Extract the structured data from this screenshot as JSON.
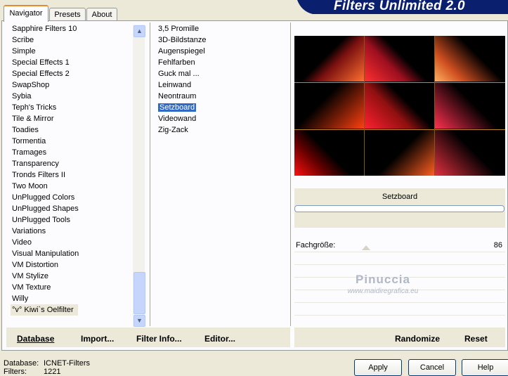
{
  "app": {
    "title": "Filters Unlimited 2.0"
  },
  "tabs": [
    {
      "label": "Navigator",
      "active": true
    },
    {
      "label": "Presets",
      "active": false
    },
    {
      "label": "About",
      "active": false
    }
  ],
  "categories": [
    "Sapphire Filters 10",
    "Scribe",
    "Simple",
    "Special Effects 1",
    "Special Effects 2",
    "SwapShop",
    "Sybia",
    "Teph's Tricks",
    "Tile & Mirror",
    "Toadies",
    "Tormentia",
    "Tramages",
    "Transparency",
    "Tronds Filters II",
    "Two Moon",
    "UnPlugged Colors",
    "UnPlugged Shapes",
    "UnPlugged Tools",
    "Variations",
    "Video",
    "Visual Manipulation",
    "VM Distortion",
    "VM Stylize",
    "VM Texture",
    "Willy",
    "°v° Kiwi`s Oelfilter"
  ],
  "selected_category": "°v° Kiwi`s Oelfilter",
  "filters": [
    "3,5 Promille",
    "3D-Bildstanze",
    "Augenspiegel",
    "Fehlfarben",
    "Guck mal ...",
    "Leinwand",
    "Neontraum",
    "Setzboard",
    "Videowand",
    "Zig-Zack"
  ],
  "selected_filter": "Setzboard",
  "scrollbar": {
    "up_icon": "triangle-up",
    "down_icon": "triangle-down"
  },
  "left_buttons": {
    "database": "Database",
    "import": "Import...",
    "filter_info": "Filter Info...",
    "editor": "Editor..."
  },
  "preview": {
    "effect_name": "Setzboard"
  },
  "params": [
    {
      "label": "Fachgröße:",
      "value": "86"
    }
  ],
  "right_buttons": {
    "randomize": "Randomize",
    "reset": "Reset"
  },
  "watermark": {
    "line1": "Pinuccia",
    "line2": "www.maidiregrafica.eu"
  },
  "status": {
    "database_label": "Database:",
    "database_value": "ICNET-Filters",
    "filters_label": "Filters:",
    "filters_value": "1221"
  },
  "dialog_buttons": {
    "apply": "Apply",
    "cancel": "Cancel",
    "help": "Help"
  },
  "colors": {
    "banner": "#0a1f6e",
    "selection": "#316ac5",
    "tab_accent": "#e68b2c"
  }
}
